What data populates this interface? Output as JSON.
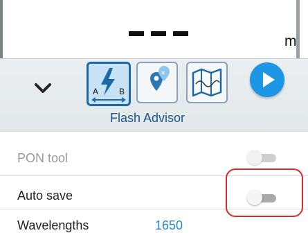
{
  "readout": {
    "value": "---",
    "unit": "m"
  },
  "toolbar": {
    "collapse_icon": "chevron-down-icon",
    "tools": [
      {
        "name": "flash-advisor",
        "icon": "lightning-ab-icon",
        "active": true
      },
      {
        "name": "geo-locate",
        "icon": "map-pin-icon",
        "active": false
      },
      {
        "name": "map-view",
        "icon": "folded-map-icon",
        "active": false
      }
    ],
    "active_label": "Flash Advisor",
    "play_icon": "play-icon",
    "accent": "#1e96e6"
  },
  "settings": {
    "pon_tool": {
      "label": "PON tool",
      "enabled": false,
      "disabled": true
    },
    "auto_save": {
      "label": "Auto save",
      "enabled": false
    },
    "wavelengths": {
      "label": "Wavelengths",
      "value": "1650",
      "value_color": "#1e8ad6"
    }
  }
}
